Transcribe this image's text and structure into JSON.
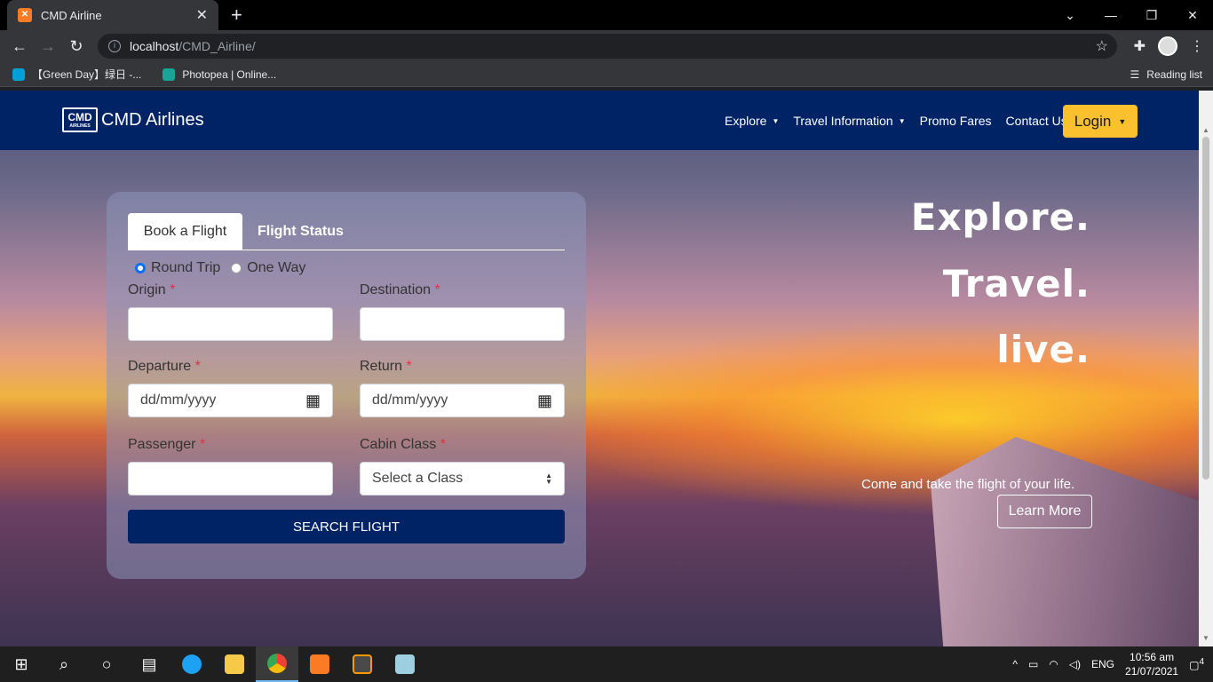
{
  "browser": {
    "tab_title": "CMD Airline",
    "url_host": "localhost",
    "url_path": "/CMD_Airline/",
    "bookmarks": [
      {
        "label": "【Green Day】绿日 -...",
        "icon": "bilibili-icon",
        "color": "#00a1d6"
      },
      {
        "label": "Photopea | Online...",
        "icon": "photopea-icon",
        "color": "#18a497"
      }
    ],
    "reading_list": "Reading list"
  },
  "navbar": {
    "brand_logo_text": "CMD",
    "brand_logo_sub": "AIRLINES",
    "brand_name": "CMD Airlines",
    "menu": [
      "Explore",
      "Travel Information",
      "Promo Fares",
      "Contact Us"
    ],
    "login": "Login"
  },
  "booking": {
    "tabs": [
      "Book a Flight",
      "Flight Status"
    ],
    "trip_types": [
      "Round Trip",
      "One Way"
    ],
    "selected_trip_type": "Round Trip",
    "fields": {
      "origin_label": "Origin",
      "destination_label": "Destination",
      "departure_label": "Departure",
      "return_label": "Return",
      "passenger_label": "Passenger",
      "cabin_label": "Cabin Class",
      "required_mark": "*",
      "departure_placeholder": "dd/mm/yyyy",
      "return_placeholder": "dd/mm/yyyy",
      "cabin_selected": "Select a Class"
    },
    "search_button": "SEARCH FLIGHT"
  },
  "hero": {
    "lines": [
      "Explore.",
      "Travel.",
      "live."
    ],
    "tagline": "Come and take the flight of your life.",
    "cta": "Learn More"
  },
  "taskbar": {
    "language": "ENG",
    "time": "10:56 am",
    "date": "21/07/2021",
    "notifications": "4"
  },
  "colors": {
    "navbar": "#002366",
    "login": "#fbc02d",
    "required": "#dc3545"
  }
}
